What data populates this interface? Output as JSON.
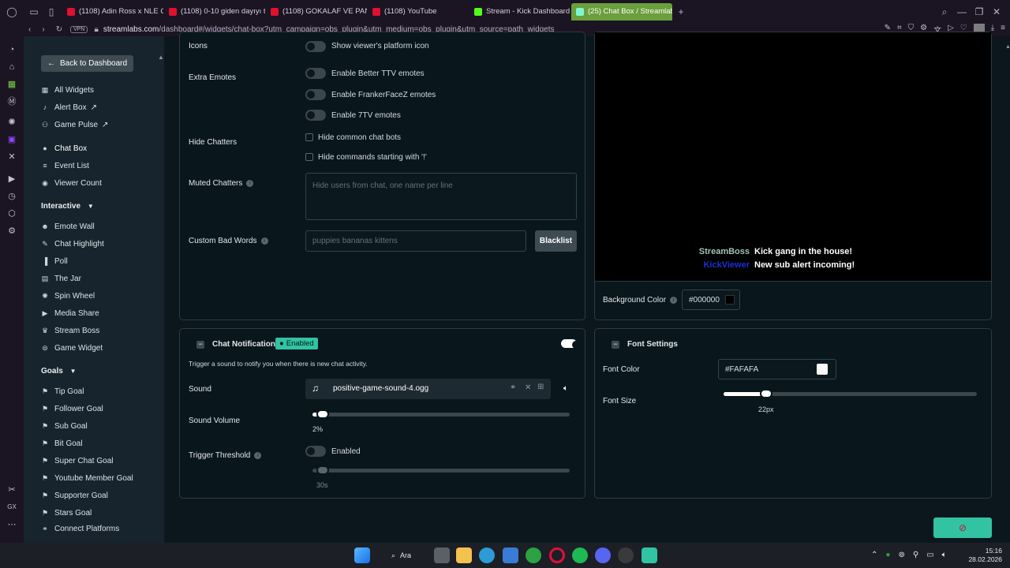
{
  "browser": {
    "tabs": [
      {
        "title": "(1108) Adin Ross x NLE Ch",
        "color": "#e0102f"
      },
      {
        "title": "(1108) 0-10 giden dayıyı ta",
        "color": "#e0102f"
      },
      {
        "title": "(1108) GOKALAF VE PANK",
        "color": "#e0102f"
      },
      {
        "title": "(1108) YouTube",
        "color": "#e0102f"
      },
      {
        "title": "Stream - Kick Dashboard",
        "color": "#53fc18"
      },
      {
        "title": "(25) Chat Box / Streamlabs",
        "color": "#80f5d2"
      }
    ],
    "vpn_label": "VPN",
    "url_domain": "streamlabs.com",
    "url_path": "/dashboard#/widgets/chat-box?utm_campaign=obs_plugin&utm_medium=obs_plugin&utm_source=path_widgets"
  },
  "sidebar": {
    "back_label": "Back to Dashboard",
    "items": [
      {
        "label": "All Widgets",
        "icon": "grid-icon"
      },
      {
        "label": "Alert Box",
        "icon": "bell-icon",
        "external": true
      },
      {
        "label": "Game Pulse",
        "icon": "pulse-icon",
        "external": true
      },
      {
        "label": "Chat Box",
        "icon": "chat-icon",
        "active": true
      },
      {
        "label": "Event List",
        "icon": "list-icon"
      },
      {
        "label": "Viewer Count",
        "icon": "eye-icon"
      }
    ],
    "interactive_title": "Interactive",
    "interactive_items": [
      {
        "label": "Emote Wall",
        "icon": "emote-icon"
      },
      {
        "label": "Chat Highlight",
        "icon": "highlight-icon"
      },
      {
        "label": "Poll",
        "icon": "poll-icon"
      },
      {
        "label": "The Jar",
        "icon": "jar-icon"
      },
      {
        "label": "Spin Wheel",
        "icon": "wheel-icon"
      },
      {
        "label": "Media Share",
        "icon": "media-icon"
      },
      {
        "label": "Stream Boss",
        "icon": "boss-icon"
      },
      {
        "label": "Game Widget",
        "icon": "gamepad-icon"
      }
    ],
    "goals_title": "Goals",
    "goal_items": [
      {
        "label": "Tip Goal",
        "icon": "goal-icon"
      },
      {
        "label": "Follower Goal",
        "icon": "goal-icon"
      },
      {
        "label": "Sub Goal",
        "icon": "goal-icon"
      },
      {
        "label": "Bit Goal",
        "icon": "goal-icon"
      },
      {
        "label": "Super Chat Goal",
        "icon": "goal-icon"
      },
      {
        "label": "Youtube Member Goal",
        "icon": "goal-icon"
      },
      {
        "label": "Supporter Goal",
        "icon": "goal-icon"
      },
      {
        "label": "Stars Goal",
        "icon": "goal-icon"
      }
    ],
    "connect_label": "Connect Platforms"
  },
  "settings": {
    "icons_label": "Icons",
    "icons_toggle": "Show viewer's platform icon",
    "extra_emotes_label": "Extra Emotes",
    "emote_toggles": [
      "Enable Better TTV emotes",
      "Enable FrankerFaceZ emotes",
      "Enable 7TV emotes"
    ],
    "hide_chatters_label": "Hide Chatters",
    "hide_checks": [
      "Hide common chat bots",
      "Hide commands starting with '!'"
    ],
    "muted_label": "Muted Chatters",
    "muted_placeholder": "Hide users from chat, one name per line",
    "bad_words_label": "Custom Bad Words",
    "bad_words_placeholder": "puppies bananas kittens",
    "blacklist_label": "Blacklist"
  },
  "preview": {
    "messages": [
      {
        "user": "StreamBoss",
        "user_color": "#9fc3b8",
        "text": "Kick gang in the house!"
      },
      {
        "user": "KickViewer",
        "user_color": "#1a2fd6",
        "text": "New sub alert incoming!"
      }
    ],
    "bg_label": "Background Color",
    "bg_value": "#000000"
  },
  "notifications": {
    "title": "Chat Notifications",
    "badge": "Enabled",
    "enabled": true,
    "description": "Trigger a sound to notify you when there is new chat activity.",
    "sound_label": "Sound",
    "sound_file": "positive-game-sound-4.ogg",
    "volume_label": "Sound Volume",
    "volume_value": "2%",
    "volume_fraction": 0.02,
    "threshold_label": "Trigger Threshold",
    "threshold_toggle": "Enabled",
    "threshold_value": "30s"
  },
  "font": {
    "title": "Font Settings",
    "color_label": "Font Color",
    "color_value": "#FAFAFA",
    "size_label": "Font Size",
    "size_value": "22px",
    "size_fraction": 0.15
  },
  "taskbar": {
    "search_label": "Ara",
    "time": "15:16",
    "date": "28.02.2026"
  }
}
